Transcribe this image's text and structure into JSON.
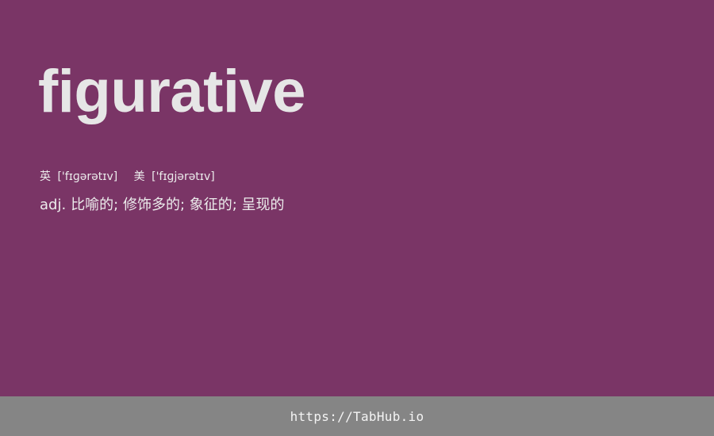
{
  "entry": {
    "word": "figurative",
    "phonetics": [
      {
        "lang": "英",
        "ipa": "['fɪɡərətɪv]"
      },
      {
        "lang": "美",
        "ipa": "['fɪɡjərətɪv]"
      }
    ],
    "definition": {
      "pos": "adj.",
      "meaning": "比喻的; 修饰多的; 象征的; 呈现的"
    }
  },
  "footer": {
    "link_text": "https://TabHub.io"
  },
  "colors": {
    "background": "#7a3566",
    "text": "#e6e6e6",
    "footer_bg": "#858585"
  }
}
